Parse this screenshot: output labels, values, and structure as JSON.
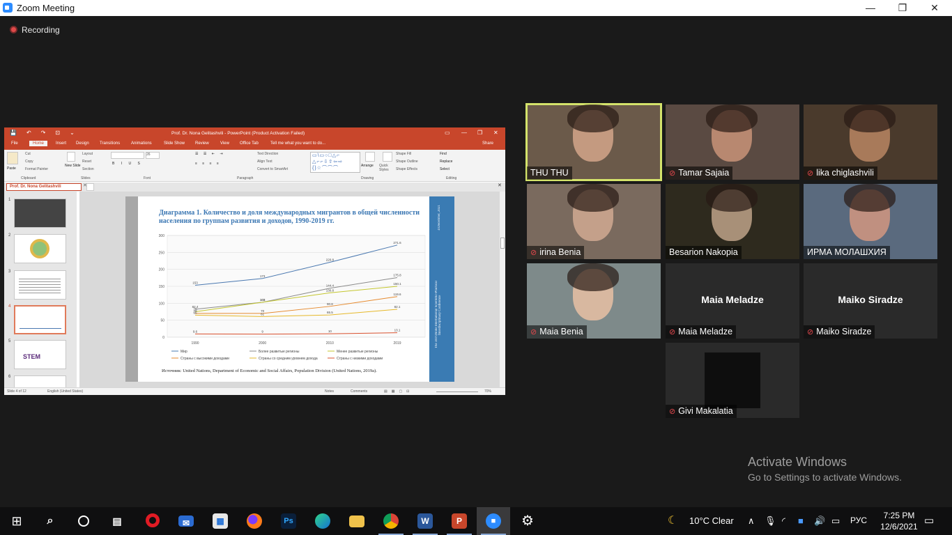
{
  "window": {
    "title": "Zoom Meeting",
    "minimize": "—",
    "restore": "❐",
    "close": "✕"
  },
  "recording": {
    "label": "Recording"
  },
  "ppt": {
    "title": "Prof. Dr. Nona Gelitashvili - PowerPoint (Product Activation Failed)",
    "tabs": [
      "File",
      "Home",
      "Insert",
      "Design",
      "Transitions",
      "Animations",
      "Slide Show",
      "Review",
      "View",
      "Office Tab"
    ],
    "tell_me": "Tell me what you want to do...",
    "share": "Share",
    "ribbon": {
      "clipboard": "Clipboard",
      "slides": "Slides",
      "font": "Font",
      "paragraph": "Paragraph",
      "drawing": "Drawing",
      "editing": "Editing",
      "paste": "Paste",
      "cut": "Cut",
      "copy": "Copy",
      "format_painter": "Format Painter",
      "new_slide": "New Slide",
      "layout": "Layout",
      "reset": "Reset",
      "section": "Section",
      "font_size": "26",
      "text_direction": "Text Direction",
      "align_text": "Align Text",
      "convert_smartart": "Convert to SmartArt",
      "arrange": "Arrange",
      "quick_styles": "Quick Styles",
      "shape_fill": "Shape Fill",
      "shape_outline": "Shape Outline",
      "shape_effects": "Shape Effects",
      "find": "Find",
      "replace": "Replace",
      "select": "Select"
    },
    "doc_tab": "Prof. Dr. Nona Gelitashvili",
    "slide_numbers": [
      "1",
      "2",
      "3",
      "4",
      "5",
      "6"
    ],
    "slide": {
      "title": "Диаграмма 1. Количество и доля международных мигрантов в общей численности населения по группам развития  и доходов, 1990-2019 гг.",
      "source": "Источник: United Nations, Department of Economic and Social Affairs, Population Division (United Nations, 2019a).",
      "side_text": "The 3rd Online International Scientific-Practical Interdisciplinary Conference",
      "side_date": "4 December, 2021"
    },
    "status": {
      "slide": "Slide 4 of 12",
      "language": "English (United States)",
      "notes": "Notes",
      "comments": "Comments",
      "zoom": "70%"
    }
  },
  "chart_data": {
    "type": "line",
    "title": "",
    "x": [
      1990,
      2000,
      2010,
      2019
    ],
    "ylim": [
      0,
      300
    ],
    "yticks": [
      0,
      50,
      100,
      150,
      200,
      250,
      300
    ],
    "grid": true,
    "legend_position": "bottom",
    "series": [
      {
        "name": "Мир",
        "values": [
          153,
          173,
          220.8,
          271.6
        ],
        "labels": [
          "153",
          "173",
          "220.8",
          "271.6"
        ],
        "color": "#4a78b0"
      },
      {
        "name": "Более развитые регионы",
        "values": [
          82.4,
          103,
          144.4,
          175.8
        ],
        "labels": [
          "82.4",
          "103",
          "144.4",
          "175.8"
        ],
        "color": "#8a8a8a"
      },
      {
        "name": "Менее развитые регионы",
        "values": [
          75,
          103,
          130.8,
          150.1
        ],
        "labels": [
          "75",
          "103",
          "130.8",
          "150.1"
        ],
        "color": "#c4c62e"
      },
      {
        "name": "Страны с высокими доходами",
        "values": [
          70,
          70,
          90.8,
          119.6
        ],
        "labels": [
          "70",
          "70",
          "90.8",
          "119.6"
        ],
        "color": "#e68a2e"
      },
      {
        "name": "Страны со средним уровнем дохода",
        "values": [
          65,
          61,
          65.5,
          82.1
        ],
        "labels": [
          "65",
          "61",
          "65.5",
          "82.1"
        ],
        "color": "#e6b829"
      },
      {
        "name": "Страны с низкими доходами",
        "values": [
          9.6,
          9,
          10,
          13.1
        ],
        "labels": [
          "9.6",
          "9",
          "10",
          "13.1"
        ],
        "color": "#d9502e"
      }
    ]
  },
  "participants": [
    {
      "name": "THU THU",
      "muted": false,
      "speaking": true,
      "video": true,
      "bg": "#6b5a4a",
      "face": "#c49a80"
    },
    {
      "name": "Tamar Sajaia",
      "muted": true,
      "speaking": false,
      "video": true,
      "bg": "#5a4a42",
      "face": "#b88870"
    },
    {
      "name": "lika chiglashvili",
      "muted": true,
      "speaking": false,
      "video": true,
      "bg": "#4a3a2c",
      "face": "#a87a5a"
    },
    {
      "name": "irina Benia",
      "muted": true,
      "speaking": false,
      "video": true,
      "bg": "#7a6a5e",
      "face": "#c4a08a"
    },
    {
      "name": "Besarion Nakopia",
      "muted": false,
      "speaking": false,
      "video": true,
      "bg": "#2e2a1e",
      "face": "#a89078"
    },
    {
      "name": "ИРМА МОЛАШХИЯ",
      "muted": false,
      "speaking": false,
      "video": true,
      "bg": "#5a6a7e",
      "face": "#c09080"
    },
    {
      "name": "Maia Benia",
      "muted": true,
      "speaking": false,
      "video": true,
      "bg": "#7e8a8a",
      "face": "#d8b8a0"
    },
    {
      "name": "Maia Meladze",
      "muted": true,
      "speaking": false,
      "video": false
    },
    {
      "name": "Maiko Siradze",
      "muted": true,
      "speaking": false,
      "video": false
    },
    {
      "name": "Givi Makalatia",
      "muted": true,
      "speaking": false,
      "video": "black"
    }
  ],
  "activation": {
    "line1": "Activate Windows",
    "line2": "Go to Settings to activate Windows."
  },
  "taskbar": {
    "weather": "10°C  Clear",
    "language": "РУС",
    "time": "7:25 PM",
    "date": "12/6/2021"
  }
}
